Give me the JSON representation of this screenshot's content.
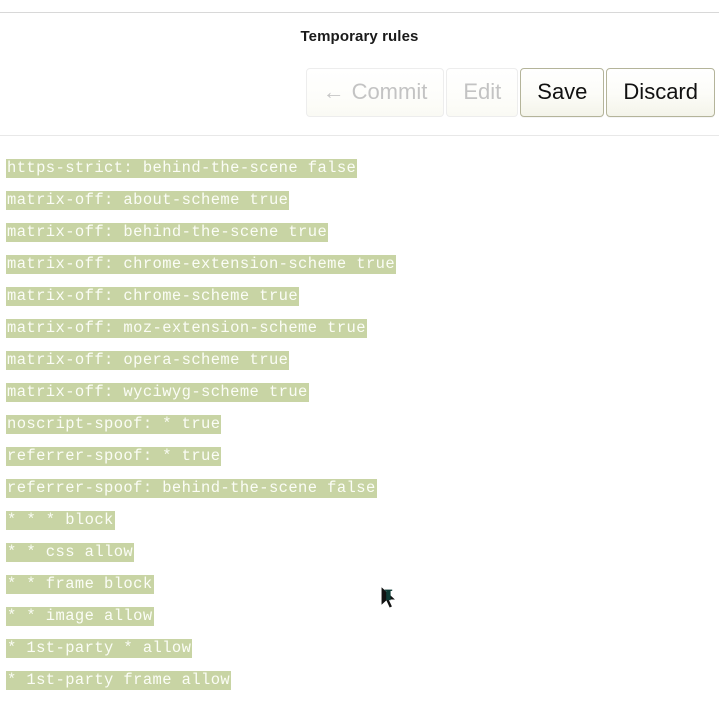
{
  "header": {
    "title": "Temporary rules"
  },
  "toolbar": {
    "commit_label": "Commit",
    "commit_icon": "arrow-left-icon",
    "commit_icon_glyph": "←",
    "edit_label": "Edit",
    "save_label": "Save",
    "discard_label": "Discard"
  },
  "rules": [
    "https-strict: behind-the-scene false",
    "matrix-off: about-scheme true",
    "matrix-off: behind-the-scene true",
    "matrix-off: chrome-extension-scheme true",
    "matrix-off: chrome-scheme true",
    "matrix-off: moz-extension-scheme true",
    "matrix-off: opera-scheme true",
    "matrix-off: wyciwyg-scheme true",
    "noscript-spoof: * true",
    "referrer-spoof: * true",
    "referrer-spoof: behind-the-scene false",
    "* * * block",
    "* * css allow",
    "* * frame block",
    "* * image allow",
    "* 1st-party * allow",
    "* 1st-party frame allow"
  ],
  "colors": {
    "rule_highlight": "#c8d4a4",
    "rule_text": "#fbfdf6",
    "page_background": "#ffffff",
    "button_border_enabled": "#b4b49a",
    "button_text_disabled": "#c3c3c3",
    "divider": "#d8d8d8"
  }
}
